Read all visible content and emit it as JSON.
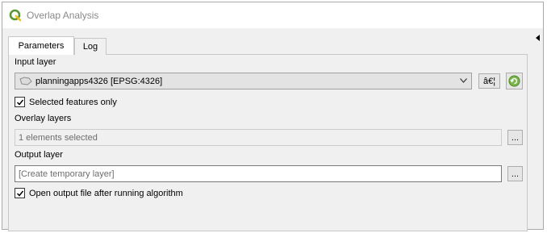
{
  "window": {
    "title": "Overlap Analysis",
    "app_icon": "qgis-logo-icon",
    "accent_color": "#589632"
  },
  "tabs": [
    {
      "label": "Parameters",
      "active": true
    },
    {
      "label": "Log",
      "active": false
    }
  ],
  "input_layer": {
    "label": "Input layer",
    "value": "planningapps4326 [EPSG:4326]",
    "layer_icon": "polygon-layer-icon",
    "select_button_label": "â€¦",
    "iterate_icon": "iterate-icon"
  },
  "selected_features_only": {
    "label": "Selected features only",
    "checked": true
  },
  "overlay_layers": {
    "label": "Overlay layers",
    "value": "1 elements selected",
    "browse_label": "..."
  },
  "output_layer": {
    "label": "Output layer",
    "placeholder": "[Create temporary layer]",
    "browse_label": "..."
  },
  "open_output": {
    "label": "Open output file after running algorithm",
    "checked": true
  }
}
